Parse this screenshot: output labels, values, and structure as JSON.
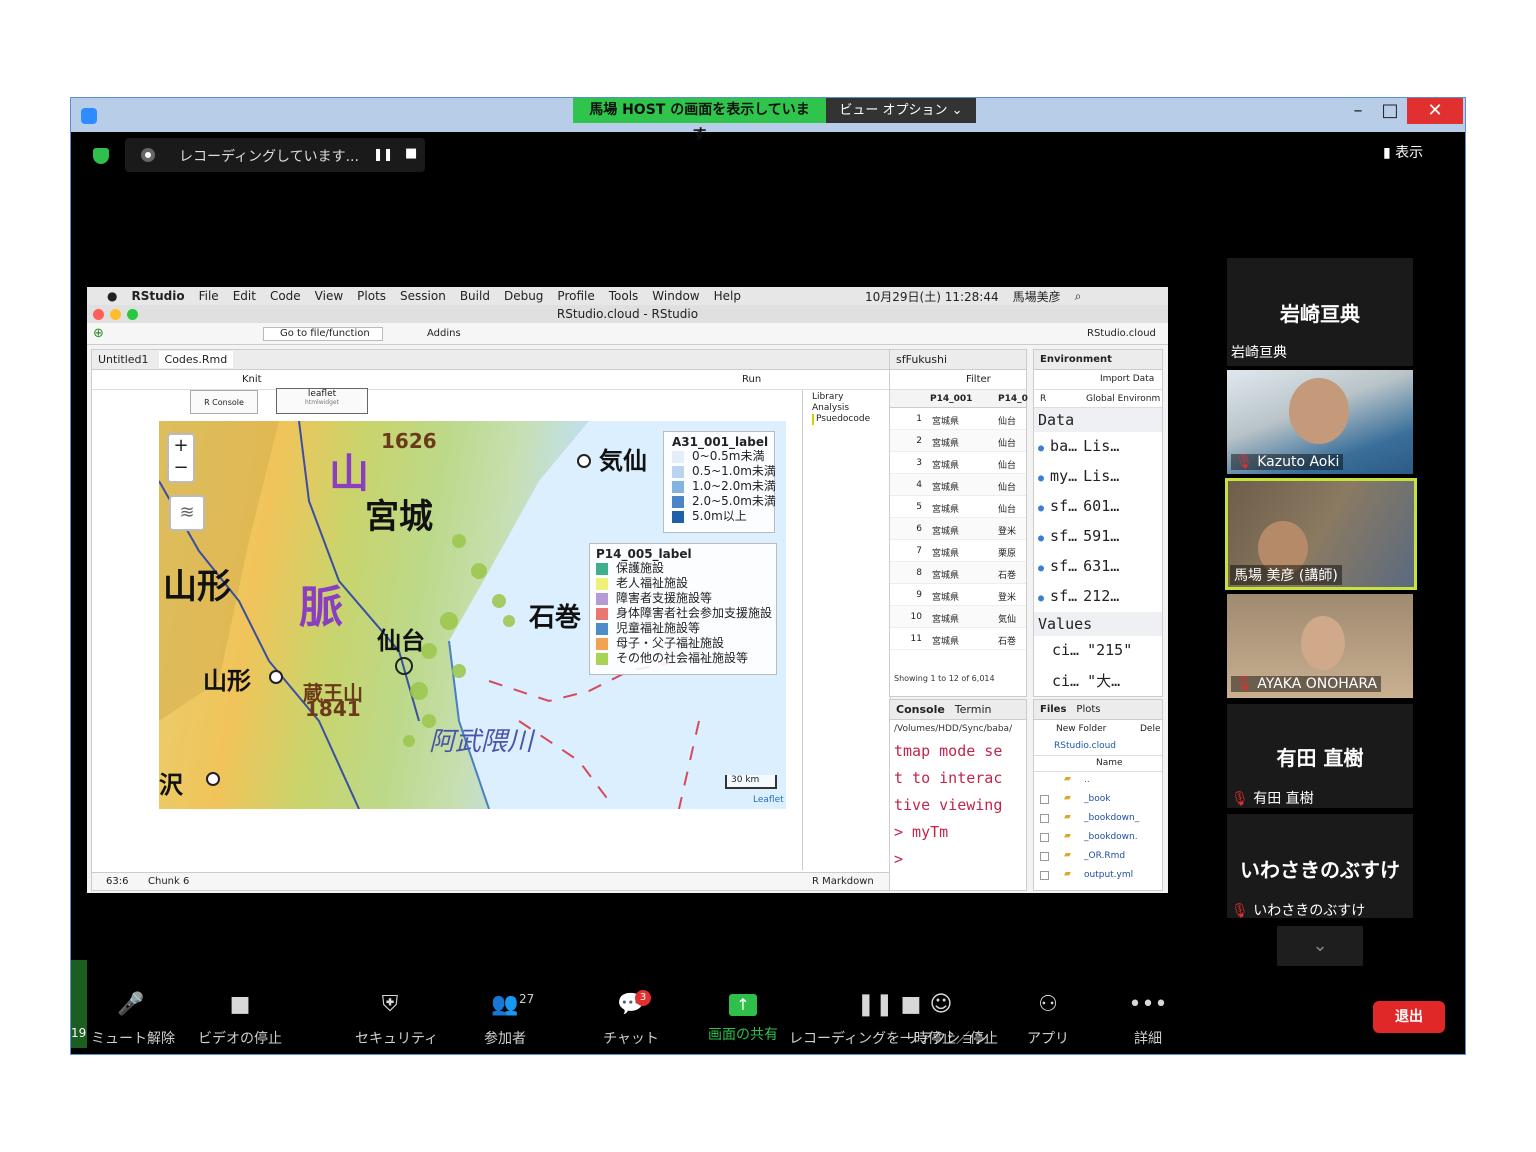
{
  "share_banner": {
    "text": "馬場 HOST の画面を表示しています",
    "view_options": "ビュー オプション ⌄"
  },
  "window_controls": {
    "minimize": "–",
    "maximize": "□",
    "close": "✕"
  },
  "recording": {
    "text": "レコーディングしています...",
    "pause": "❚❚",
    "stop": "■"
  },
  "view_button": "表示",
  "rstudio": {
    "menu": [
      "RStudio",
      "File",
      "Edit",
      "Code",
      "View",
      "Plots",
      "Session",
      "Build",
      "Debug",
      "Profile",
      "Tools",
      "Window",
      "Help"
    ],
    "menu_status": "10月29日(土) 11:28:44",
    "menu_user": "馬場美彦",
    "title": "RStudio.cloud - RStudio",
    "toolbar": {
      "goto": "Go to file/function",
      "addins": "Addins",
      "project": "RStudio.cloud"
    },
    "editor_tabs": [
      "Untitled1",
      "Codes.Rmd"
    ],
    "editor_toolbar": {
      "knit": "Knit",
      "run": "Run"
    },
    "chunk_buttons": {
      "console": "R Console",
      "leaflet": "leaflet",
      "leaflet_sub": "htmlwidget"
    },
    "outline": [
      "Library",
      "Analysis",
      "Psuedocode"
    ],
    "status": {
      "position": "63:6",
      "chunk": "Chunk 6",
      "mode": "R Markdown"
    },
    "map": {
      "legend1_title": "A31_001_label",
      "legend1": [
        {
          "label": "0~0.5m未満",
          "color": "#e3eef9"
        },
        {
          "label": "0.5~1.0m未満",
          "color": "#b9d4ef"
        },
        {
          "label": "1.0~2.0m未満",
          "color": "#84b3df"
        },
        {
          "label": "2.0~5.0m未満",
          "color": "#4a86c7"
        },
        {
          "label": "5.0m以上",
          "color": "#1f5ea8"
        }
      ],
      "legend2_title": "P14_005_label",
      "legend2": [
        {
          "label": "保護施設",
          "color": "#3fae8f"
        },
        {
          "label": "老人福祉施設",
          "color": "#eef07a"
        },
        {
          "label": "障害者支援施設等",
          "color": "#b59ad6"
        },
        {
          "label": "身体障害者社会参加支援施設",
          "color": "#e9776f"
        },
        {
          "label": "児童福祉施設等",
          "color": "#4d8cc9"
        },
        {
          "label": "母子・父子福祉施設",
          "color": "#f2a251"
        },
        {
          "label": "その他の社会福祉施設等",
          "color": "#a6d455"
        }
      ],
      "places": [
        "宮城",
        "山形",
        "山形",
        "仙台",
        "石巻",
        "気仙",
        "蔵王山",
        "1841",
        "1626",
        "阿武隈川",
        "山",
        "脈",
        "沢"
      ],
      "scale": "30 km",
      "attribution": "Leaflet",
      "zoom_in": "+",
      "zoom_out": "−"
    },
    "data_viewer": {
      "tab": "sfFukushi",
      "filter": "Filter",
      "columns": [
        "P14_001",
        "P14_0"
      ],
      "rows": [
        {
          "n": "1",
          "pref": "宮城県",
          "city": "仙台"
        },
        {
          "n": "2",
          "pref": "宮城県",
          "city": "仙台"
        },
        {
          "n": "3",
          "pref": "宮城県",
          "city": "仙台"
        },
        {
          "n": "4",
          "pref": "宮城県",
          "city": "仙台"
        },
        {
          "n": "5",
          "pref": "宮城県",
          "city": "仙台"
        },
        {
          "n": "6",
          "pref": "宮城県",
          "city": "登米"
        },
        {
          "n": "7",
          "pref": "宮城県",
          "city": "栗原"
        },
        {
          "n": "8",
          "pref": "宮城県",
          "city": "石巻"
        },
        {
          "n": "9",
          "pref": "宮城県",
          "city": "登米"
        },
        {
          "n": "10",
          "pref": "宮城県",
          "city": "気仙"
        },
        {
          "n": "11",
          "pref": "宮城県",
          "city": "石巻"
        }
      ],
      "footer": "Showing 1 to 12 of 6,014"
    },
    "console": {
      "tabs": [
        "Console",
        "Termin"
      ],
      "path": "/Volumes/HDD/Sync/baba/",
      "lines": [
        "tmap mode se",
        "t to interac",
        "tive viewing",
        "> myTm",
        "> "
      ]
    },
    "environment": {
      "tab": "Environment",
      "import": "Import Data",
      "r": "R",
      "global": "Global Environm",
      "section_data": "Data",
      "items": [
        {
          "name": "ba…",
          "value": "Lis…"
        },
        {
          "name": "my…",
          "value": "Lis…"
        },
        {
          "name": "sf…",
          "value": "601…"
        },
        {
          "name": "sf…",
          "value": "591…"
        },
        {
          "name": "sf…",
          "value": "631…"
        },
        {
          "name": "sf…",
          "value": "212…"
        }
      ],
      "section_values": "Values",
      "values": [
        {
          "name": "ci…",
          "value": "\"215\""
        },
        {
          "name": "ci…",
          "value": "\"大…"
        }
      ]
    },
    "files": {
      "tabs": [
        "Files",
        "Plots"
      ],
      "new_folder": "New Folder",
      "delete": "Dele",
      "path": "RStudio.cloud",
      "sort": "Name",
      "items": [
        "..",
        "_book",
        "_bookdown_",
        "_bookdown.",
        "_OR.Rmd",
        "output.yml"
      ]
    }
  },
  "participants": [
    {
      "type": "name",
      "display": "岩崎亘典",
      "label": "岩崎亘典"
    },
    {
      "type": "video",
      "label": "Kazuto Aoki"
    },
    {
      "type": "video",
      "label": "馬場 美彦 (講師)",
      "active": true
    },
    {
      "type": "video",
      "label": "AYAKA ONOHARA"
    },
    {
      "type": "name",
      "display": "有田 直樹",
      "label": "有田 直樹"
    },
    {
      "type": "name",
      "display": "いわさきのぶすけ",
      "label": "いわさきのぶすけ"
    }
  ],
  "controls": [
    {
      "label": "ミュート解除",
      "icon": "🎤"
    },
    {
      "label": "ビデオの停止",
      "icon": "■"
    },
    {
      "label": "セキュリティ",
      "icon": "⛨"
    },
    {
      "label": "参加者",
      "icon": "👥",
      "count": "27"
    },
    {
      "label": "チャット",
      "icon": "💬",
      "badge": "3"
    },
    {
      "label": "画面の共有",
      "icon": "↑"
    },
    {
      "label": "レコーディングを一時停止／停止",
      "icon": "❚❚ ■"
    },
    {
      "label": "リアクション",
      "icon": "☺"
    },
    {
      "label": "アプリ",
      "icon": "⚇"
    },
    {
      "label": "詳細",
      "icon": "•••"
    }
  ],
  "leave": "退出",
  "left_partial": "19"
}
